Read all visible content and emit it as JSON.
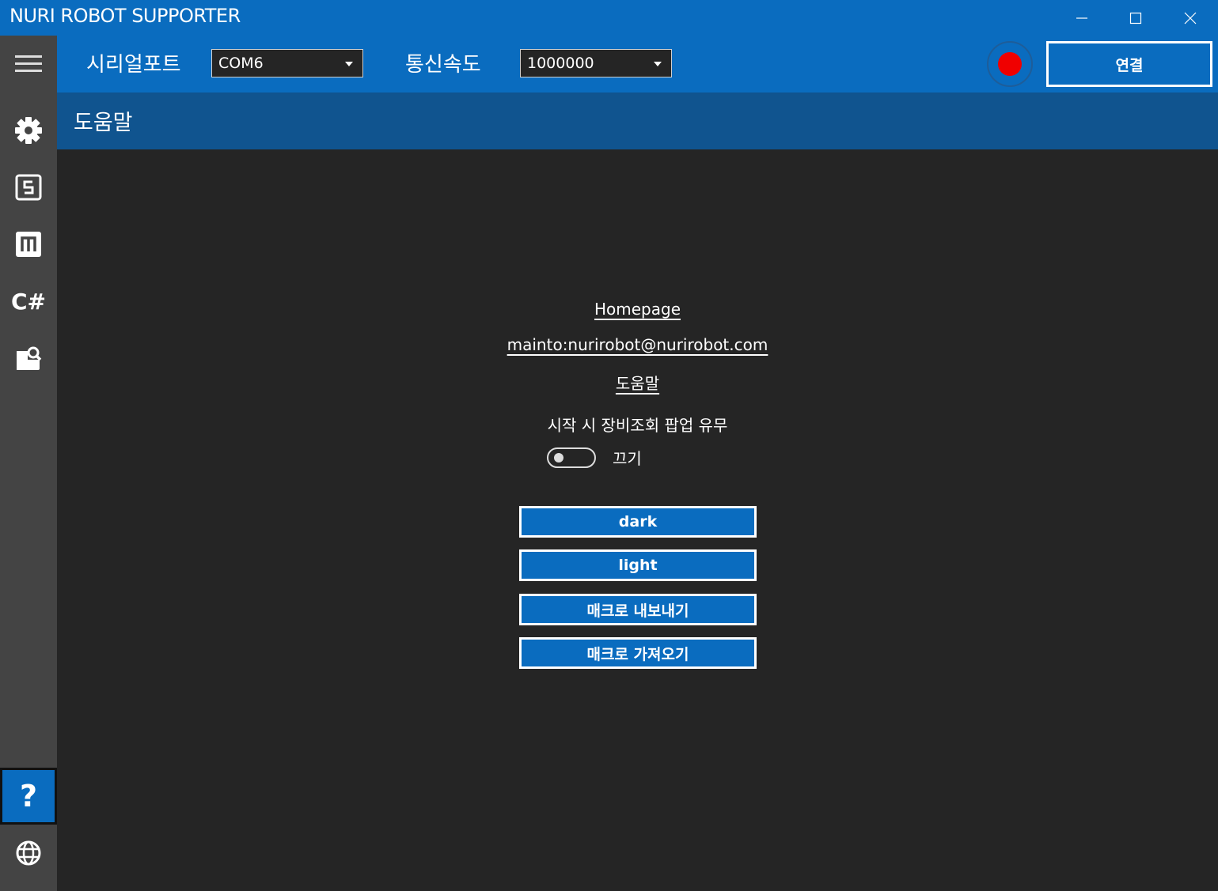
{
  "window": {
    "title": "NURI ROBOT SUPPORTER"
  },
  "toolbar": {
    "serial_port_label": "시리얼포트",
    "serial_port_value": "COM6",
    "baud_label": "통신속도",
    "baud_value": "1000000",
    "connect_label": "연결",
    "record_color": "#f00000"
  },
  "page": {
    "title": "도움말"
  },
  "help": {
    "homepage_link": "Homepage",
    "email_link": "mainto:nurirobot@nurirobot.com",
    "help_link": "도움말",
    "startup_popup_label": "시작 시 장비조회 팝업 유무",
    "startup_popup_state": "끄기",
    "buttons": [
      "dark",
      "light",
      "매크로 내보내기",
      "매크로 가져오기"
    ]
  },
  "colors": {
    "accent": "#0a6cbf",
    "header": "#10548f",
    "background": "#252525",
    "sidebar": "#444444"
  },
  "sidebar": {
    "items": [
      "menu-icon",
      "gear-icon",
      "s-box-icon",
      "m-box-icon",
      "csharp-icon",
      "document-search-icon",
      "help-icon",
      "globe-icon"
    ],
    "csharp_label": "C#",
    "help_label": "?"
  }
}
